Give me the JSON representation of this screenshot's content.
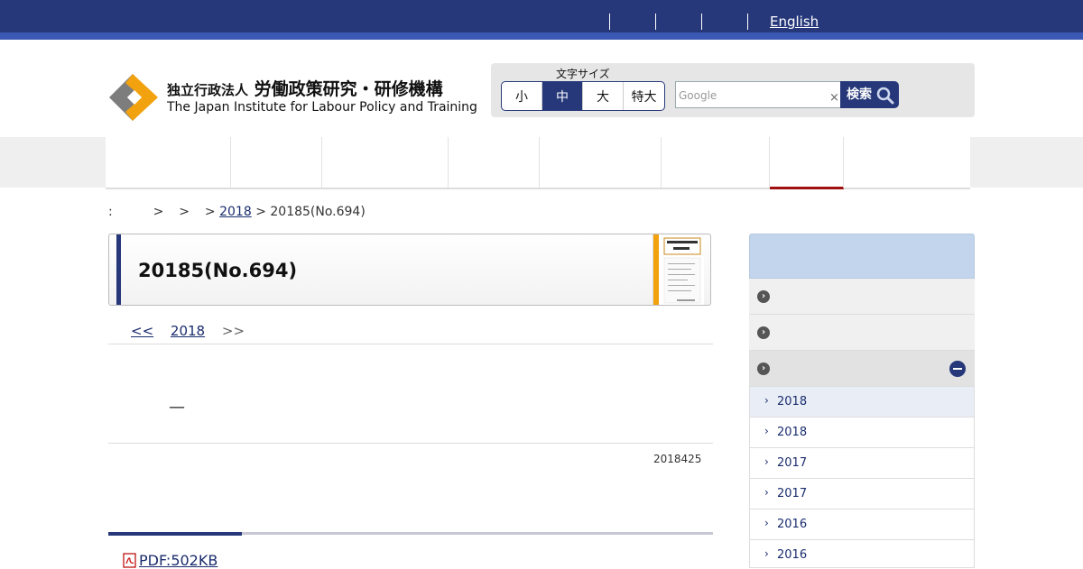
{
  "header": {
    "english_link": "English",
    "logo_ja_prefix": "独立行政法人",
    "logo_ja_main": "労働政策研究・研修機構",
    "logo_en": "The Japan Institute for Labour Policy and Training"
  },
  "font_size": {
    "label": "文字サイズ",
    "options": [
      "小",
      "中",
      "大",
      "特大"
    ],
    "selected": "中"
  },
  "search": {
    "placeholder": "Google",
    "clear_glyph": "×",
    "button_label": "検索"
  },
  "breadcrumb": {
    "prefix": ":",
    "seps": ">",
    "year_link": "2018",
    "current": "20185(No.694)"
  },
  "article": {
    "title": "20185(No.694)",
    "pager_prev": "<<",
    "pager_year": "2018",
    "pager_next": ">>",
    "dash": "—",
    "date": "2018425",
    "pdf_link": "PDF:502KB"
  },
  "sidebar": {
    "sub_items": [
      "2018",
      "2018",
      "2017",
      "2017",
      "2016",
      "2016"
    ]
  },
  "colors": {
    "navy": "#26387a",
    "accent_red": "#a01010",
    "sidebar_head": "#c2d5ec"
  }
}
